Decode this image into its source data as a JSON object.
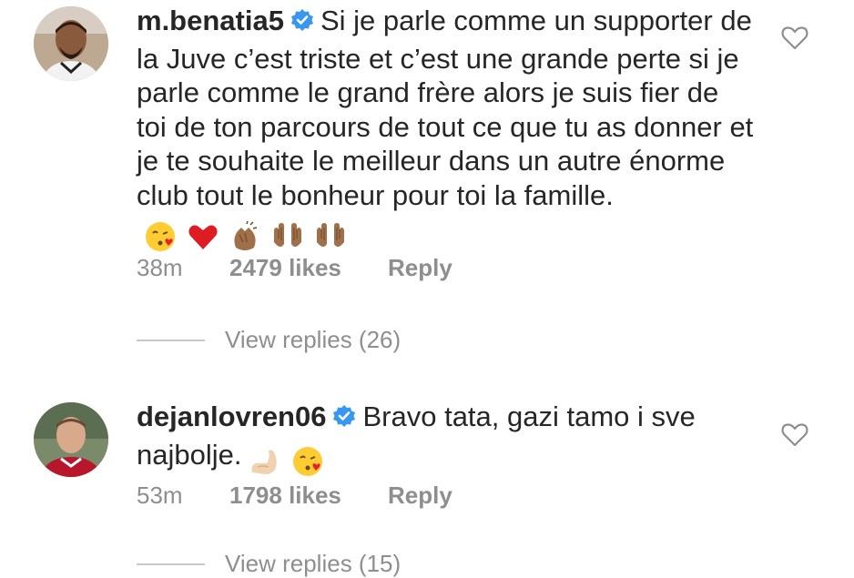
{
  "comments": [
    {
      "username": "m.benatia5",
      "text": "Si je parle comme un supporter de la Juve c’est triste et c’est une grande perte si je parle comme le grand frère alors je suis fier de toi de ton parcours de tout ce que tu as donner et je te souhaite le meilleur dans un autre énorme club tout le bonheur pour toi la famille.",
      "emojis": [
        "kissing-heart-emoji",
        "red-heart-emoji",
        "clapping-hands-emoji",
        "palms-up-emoji",
        "palms-up-emoji"
      ],
      "time": "38m",
      "likes": "2479 likes",
      "reply_label": "Reply",
      "view_replies": "View replies (26)"
    },
    {
      "username": "dejanlovren06",
      "text": "Bravo tata, gazi tamo i sve najbolje.",
      "emojis": [
        "flexed-biceps-emoji",
        "kissing-heart-emoji"
      ],
      "time": "53m",
      "likes": "1798 likes",
      "reply_label": "Reply",
      "view_replies": "View replies (15)"
    }
  ],
  "colors": {
    "text": "#262626",
    "meta": "#8e8e8e",
    "verified": "#3897f0",
    "divider": "#c7c7c7"
  }
}
